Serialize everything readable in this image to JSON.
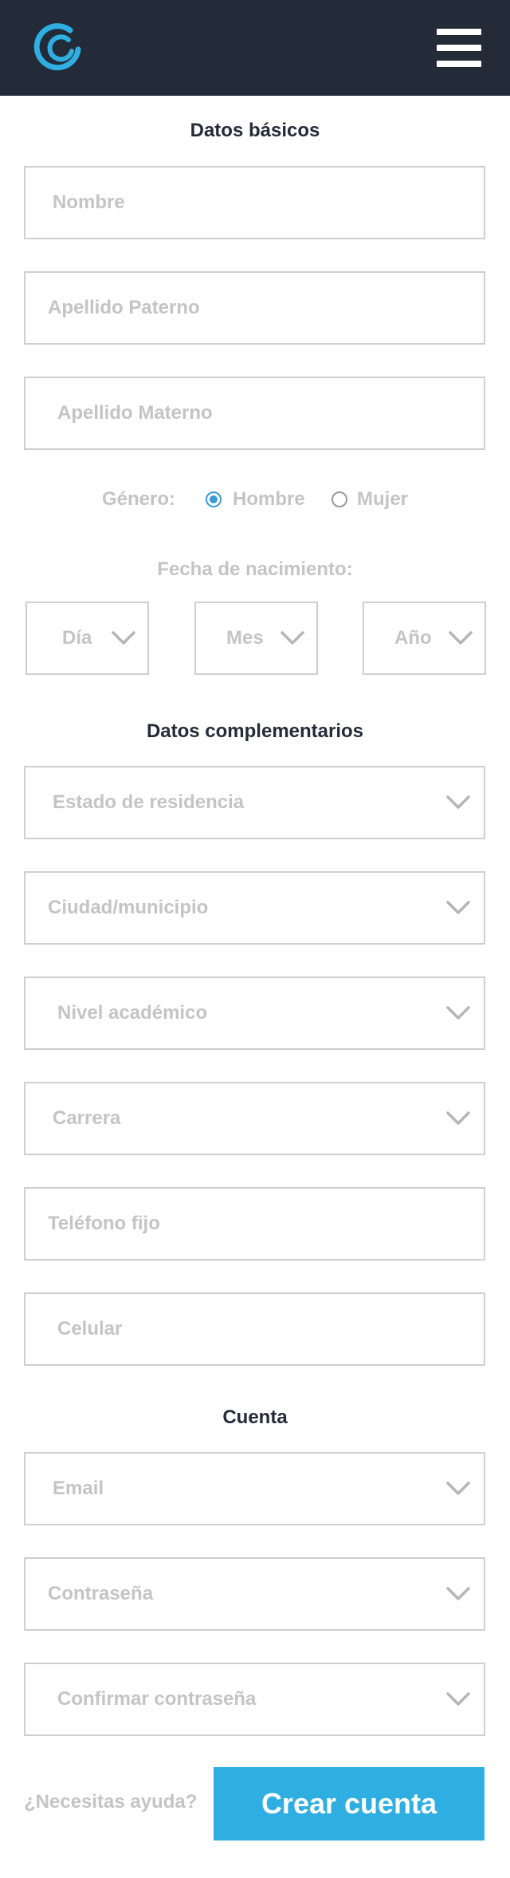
{
  "header": {
    "logo_icon": "swirl-logo-icon",
    "menu_icon": "hamburger-menu-icon"
  },
  "sections": {
    "basic": "Datos básicos",
    "extra": "Datos complementarios",
    "account": "Cuenta"
  },
  "basic": {
    "nombre_placeholder": "Nombre",
    "paterno_placeholder": "Apellido Paterno",
    "materno_placeholder": "Apellido Materno"
  },
  "gender": {
    "label": "Género:",
    "option_male": "Hombre",
    "option_female": "Mujer",
    "selected": "Hombre"
  },
  "birth": {
    "label": "Fecha de nacimiento:",
    "day": "Día",
    "month": "Mes",
    "year": "Año"
  },
  "extra": {
    "estado": "Estado de residencia",
    "ciudad": "Ciudad/municipio",
    "nivel": "Nivel académico",
    "carrera": "Carrera",
    "telefono": "Teléfono fijo",
    "celular": "Celular"
  },
  "account": {
    "email": "Email",
    "password": "Contraseña",
    "confirm": "Confirmar contraseña"
  },
  "footer": {
    "help": "¿Necesitas ayuda?",
    "submit": "Crear cuenta"
  },
  "colors": {
    "header_bg": "#242b38",
    "accent": "#2faee2",
    "radio": "#3a9bd8",
    "placeholder": "#c4c4c4",
    "border": "#cfcfcf"
  }
}
